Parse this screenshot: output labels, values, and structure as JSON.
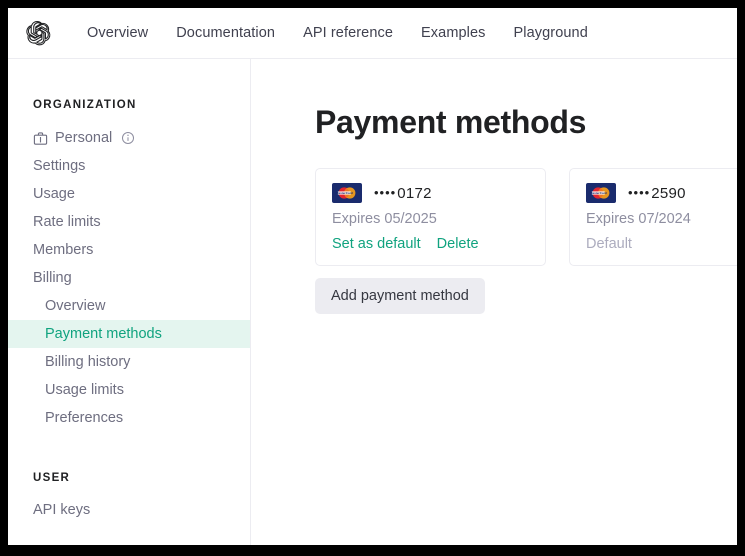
{
  "window": {
    "frame_color": "#000000"
  },
  "topnav": {
    "logo_icon": "openai-logo-icon",
    "links": [
      {
        "label": "Overview"
      },
      {
        "label": "Documentation"
      },
      {
        "label": "API reference"
      },
      {
        "label": "Examples"
      },
      {
        "label": "Playground"
      }
    ]
  },
  "sidebar": {
    "organization_label": "ORGANIZATION",
    "user_label": "USER",
    "org_items": [
      {
        "label": "Personal",
        "icon": "briefcase-icon",
        "trailing_icon": "info-circle-icon",
        "active": false
      },
      {
        "label": "Settings",
        "active": false
      },
      {
        "label": "Usage",
        "active": false
      },
      {
        "label": "Rate limits",
        "active": false
      },
      {
        "label": "Members",
        "active": false
      },
      {
        "label": "Billing",
        "active": false
      }
    ],
    "billing_items": [
      {
        "label": "Overview",
        "active": false
      },
      {
        "label": "Payment methods",
        "active": true
      },
      {
        "label": "Billing history",
        "active": false
      },
      {
        "label": "Usage limits",
        "active": false
      },
      {
        "label": "Preferences",
        "active": false
      }
    ],
    "user_items": [
      {
        "label": "API keys",
        "active": false
      }
    ],
    "active_bg_color": "#e4f5ef",
    "active_text_color": "#10a37f"
  },
  "main": {
    "title": "Payment methods",
    "add_button_label": "Add payment method",
    "cards": [
      {
        "brand_icon": "mastercard-icon",
        "dots": "••••",
        "last4": "0172",
        "expires": "Expires 05/2025",
        "actions": [
          {
            "label": "Set as default"
          },
          {
            "label": "Delete"
          }
        ],
        "default_label": null
      },
      {
        "brand_icon": "mastercard-icon",
        "dots": "••••",
        "last4": "2590",
        "expires": "Expires 07/2024",
        "actions": [],
        "default_label": "Default"
      }
    ]
  },
  "colors": {
    "accent": "#10a37f",
    "text_primary": "#202123",
    "text_muted": "#6e6e80",
    "text_faint": "#8e8ea0",
    "border": "#ececf1",
    "button_bg": "#ececf1"
  }
}
